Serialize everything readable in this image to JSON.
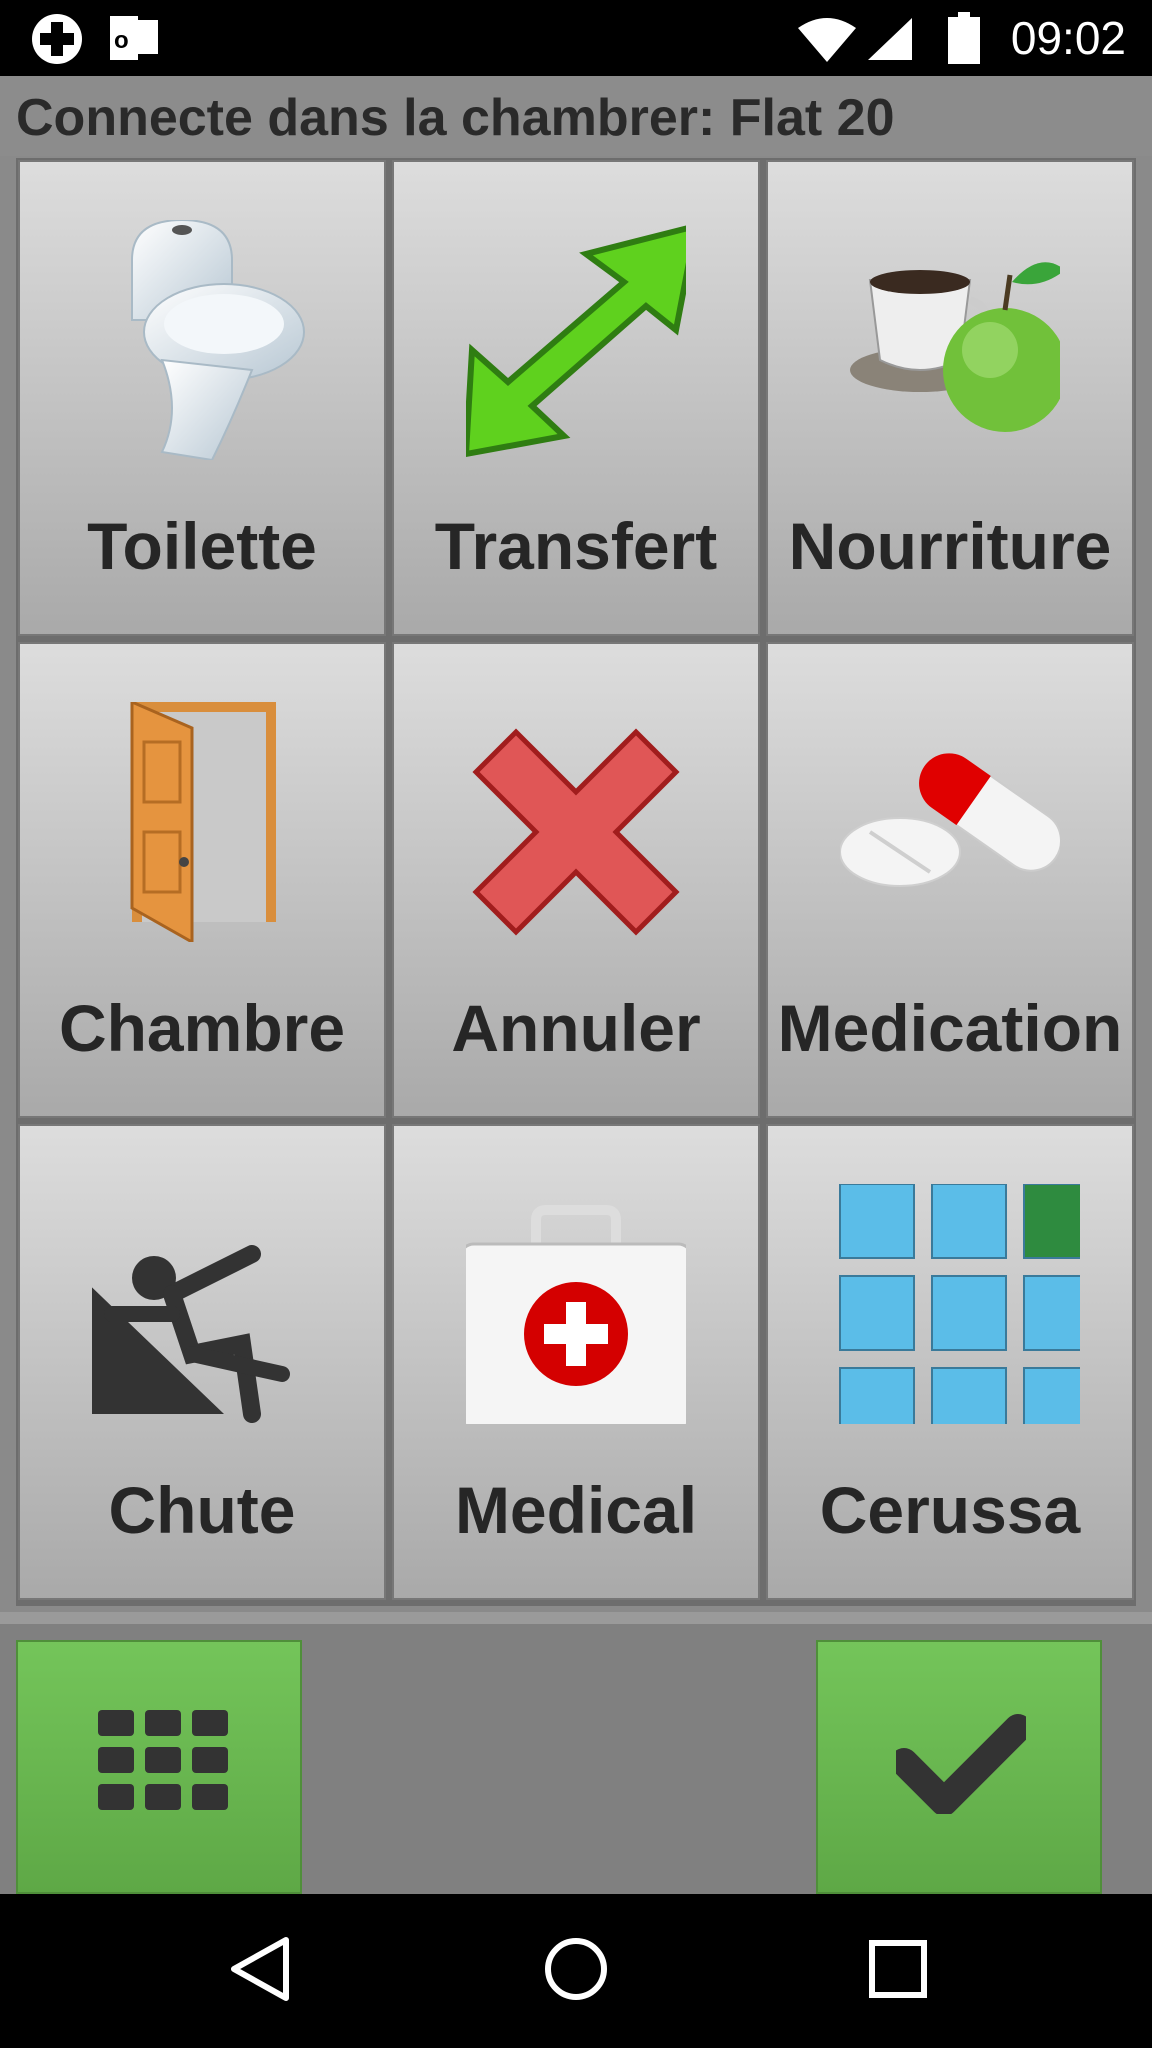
{
  "status_bar": {
    "time": "09:02",
    "icons": [
      "medical-cross-icon",
      "outlook-icon",
      "wifi-icon",
      "cell-signal-icon",
      "battery-icon"
    ]
  },
  "header": {
    "connection_text": "Connecte dans la chambrer: Flat 20"
  },
  "tiles": [
    {
      "label": "Toilette",
      "icon": "toilet-icon"
    },
    {
      "label": "Transfert",
      "icon": "transfer-arrows-icon"
    },
    {
      "label": "Nourriture",
      "icon": "food-icon"
    },
    {
      "label": "Chambre",
      "icon": "door-icon"
    },
    {
      "label": "Annuler",
      "icon": "cancel-x-icon"
    },
    {
      "label": "Medication",
      "icon": "pills-icon"
    },
    {
      "label": "Chute",
      "icon": "fall-icon"
    },
    {
      "label": "Medical",
      "icon": "first-aid-kit-icon"
    },
    {
      "label": "Cerussa",
      "icon": "app-grid-icon"
    }
  ],
  "bottom_bar": {
    "left_button_icon": "grid-menu-icon",
    "right_button_icon": "checkmark-icon",
    "accent_color": "#6ab850"
  },
  "nav_bar": {
    "icons": [
      "back-icon",
      "home-icon",
      "recents-icon"
    ]
  }
}
